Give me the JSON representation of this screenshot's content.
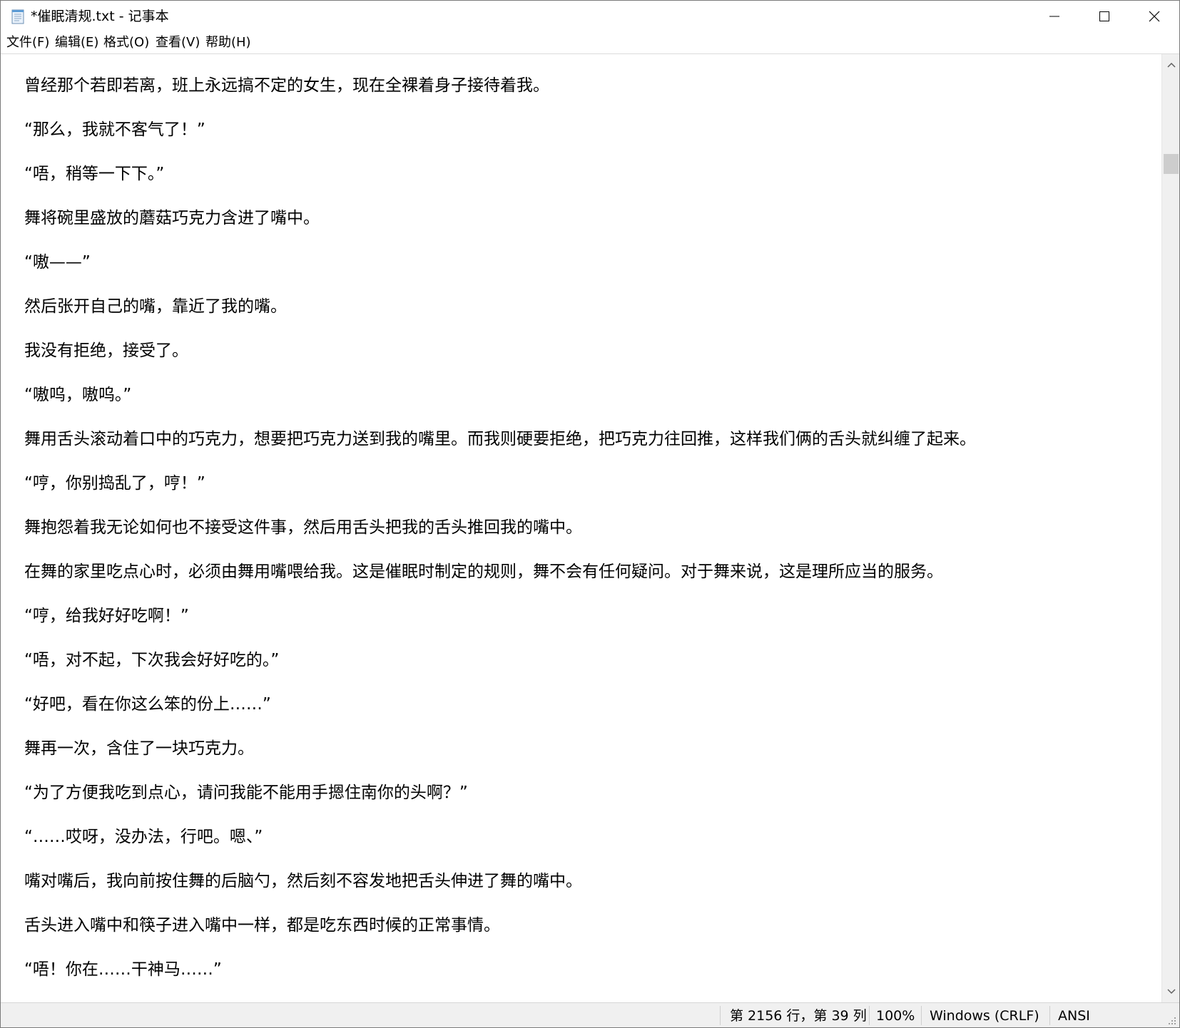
{
  "window": {
    "title": "*催眠清规.txt - 记事本"
  },
  "menu": {
    "items": [
      "文件(F)",
      "编辑(E)",
      "格式(O)",
      "查看(V)",
      "帮助(H)"
    ]
  },
  "editor": {
    "lines": [
      "曾经那个若即若离，班上永远搞不定的女生，现在全裸着身子接待着我。",
      "“那么，我就不客气了！”",
      "“唔，稍等一下下。”",
      "舞将碗里盛放的蘑菇巧克力含进了嘴中。",
      "“嗷——”",
      "然后张开自己的嘴，靠近了我的嘴。",
      "我没有拒绝，接受了。",
      "“嗷呜，嗷呜。”",
      "舞用舌头滚动着口中的巧克力，想要把巧克力送到我的嘴里。而我则硬要拒绝，把巧克力往回推，这样我们俩的舌头就纠缠了起来。",
      "“哼，你别捣乱了，哼！”",
      "舞抱怨着我无论如何也不接受这件事，然后用舌头把我的舌头推回我的嘴中。",
      "在舞的家里吃点心时，必须由舞用嘴喂给我。这是催眠时制定的规则，舞不会有任何疑问。对于舞来说，这是理所应当的服务。",
      "“哼，给我好好吃啊！”",
      "“唔，对不起，下次我会好好吃的。”",
      "“好吧，看在你这么笨的份上……”",
      "舞再一次，含住了一块巧克力。",
      "“为了方便我吃到点心，请问我能不能用手摁住南你的头啊？”",
      "“……哎呀，没办法，行吧。嗯、”",
      "嘴对嘴后，我向前按住舞的后脑勺，然后刻不容发地把舌头伸进了舞的嘴中。",
      "舌头进入嘴中和筷子进入嘴中一样，都是吃东西时候的正常事情。",
      "“唔！你在……干神马……”"
    ]
  },
  "statusbar": {
    "position": "第 2156 行，第 39 列",
    "zoom": "100%",
    "line_ending": "Windows (CRLF)",
    "encoding": "ANSI"
  },
  "icons": {
    "app": "notepad-icon",
    "minimize": "minimize-icon",
    "maximize": "maximize-icon",
    "close": "close-icon",
    "scroll_up": "chevron-up-icon",
    "scroll_down": "chevron-down-icon"
  }
}
